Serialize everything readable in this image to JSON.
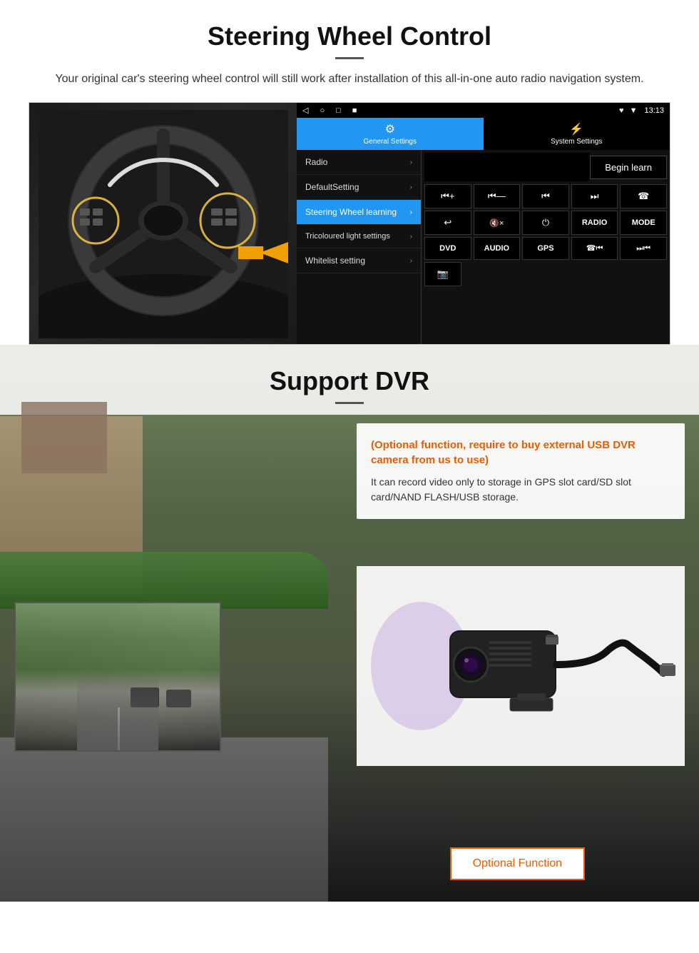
{
  "page": {
    "steering": {
      "title": "Steering Wheel Control",
      "subtitle": "Your original car's steering wheel control will still work after installation of this all-in-one auto radio navigation system.",
      "statusBar": {
        "icons": "♥ ▼ 13:13",
        "navBack": "◁",
        "navHome": "○",
        "navRecent": "□",
        "navMore": "■"
      },
      "tabs": [
        {
          "label": "General Settings",
          "icon": "⚙",
          "active": true
        },
        {
          "label": "System Settings",
          "icon": "⚡",
          "active": false
        }
      ],
      "menu": [
        {
          "label": "Radio",
          "active": false
        },
        {
          "label": "DefaultSetting",
          "active": false
        },
        {
          "label": "Steering Wheel learning",
          "active": true
        },
        {
          "label": "Tricoloured light settings",
          "active": false
        },
        {
          "label": "Whitelist setting",
          "active": false
        }
      ],
      "beginLearnBtn": "Begin learn",
      "controlButtons": [
        "⏮+",
        "⏮—",
        "⏮⏮",
        "⏭⏭",
        "☎",
        "↩",
        "🔇×",
        "⏻",
        "RADIO",
        "MODE",
        "DVD",
        "AUDIO",
        "GPS",
        "☎⏮",
        "⏭⏭"
      ],
      "bottomIcon": "📷"
    },
    "dvr": {
      "title": "Support DVR",
      "optionalText": "(Optional function, require to buy external USB DVR camera from us to use)",
      "descText": "It can record video only to storage in GPS slot card/SD slot card/NAND FLASH/USB storage.",
      "optionalFunctionBtn": "Optional Function"
    }
  }
}
